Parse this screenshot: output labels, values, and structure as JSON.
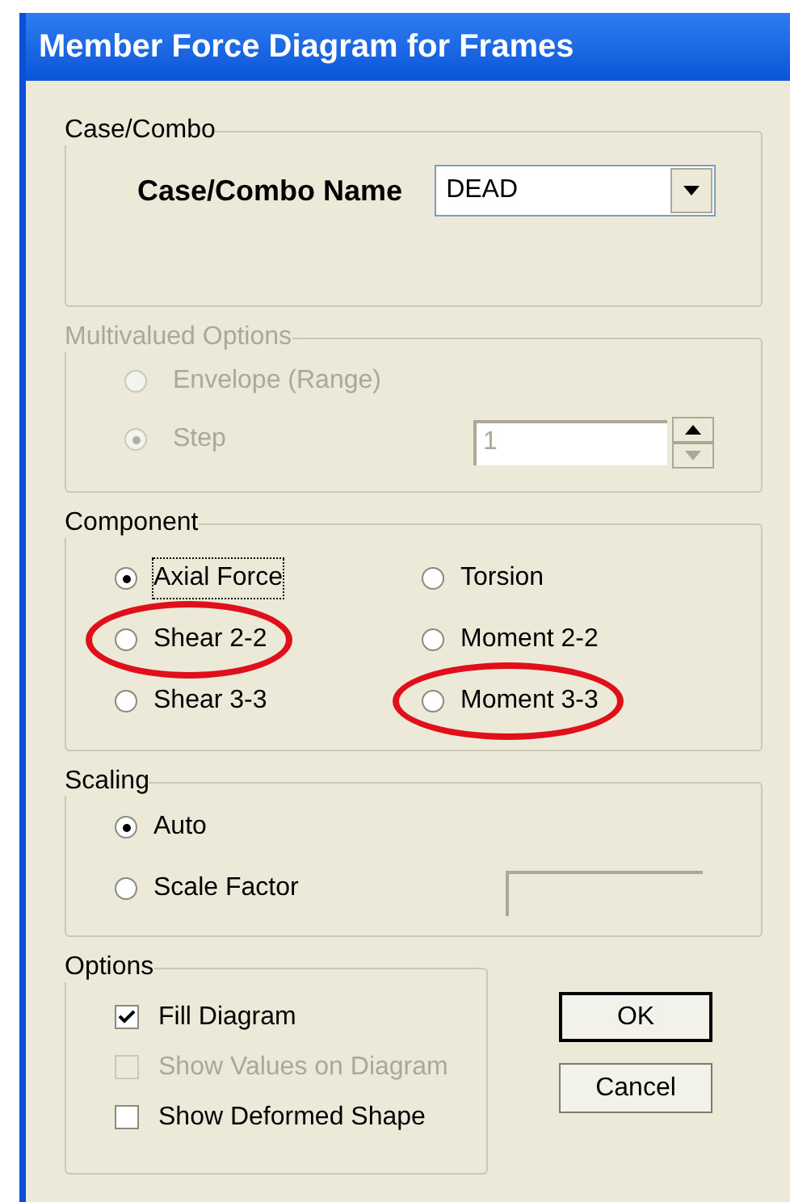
{
  "window": {
    "title": "Member Force Diagram for Frames"
  },
  "case_combo": {
    "title": "Case/Combo",
    "label": "Case/Combo Name",
    "value": "DEAD"
  },
  "multivalued": {
    "title": "Multivalued Options",
    "disabled": true,
    "options": [
      {
        "label": "Envelope (Range)",
        "selected": false
      },
      {
        "label": "Step",
        "selected": true
      }
    ],
    "step_value": "1"
  },
  "component": {
    "title": "Component",
    "options": [
      {
        "label": "Axial Force",
        "selected": true,
        "focused": true,
        "circled": false
      },
      {
        "label": "Torsion",
        "selected": false,
        "focused": false,
        "circled": false
      },
      {
        "label": "Shear 2-2",
        "selected": false,
        "focused": false,
        "circled": true
      },
      {
        "label": "Moment 2-2",
        "selected": false,
        "focused": false,
        "circled": false
      },
      {
        "label": "Shear 3-3",
        "selected": false,
        "focused": false,
        "circled": false
      },
      {
        "label": "Moment 3-3",
        "selected": false,
        "focused": false,
        "circled": true
      }
    ]
  },
  "scaling": {
    "title": "Scaling",
    "options": [
      {
        "label": "Auto",
        "selected": true
      },
      {
        "label": "Scale Factor",
        "selected": false
      }
    ]
  },
  "options": {
    "title": "Options",
    "items": [
      {
        "label": "Fill Diagram",
        "checked": true,
        "disabled": false
      },
      {
        "label": "Show Values on Diagram",
        "checked": false,
        "disabled": true
      },
      {
        "label": "Show Deformed Shape",
        "checked": false,
        "disabled": false
      }
    ]
  },
  "buttons": [
    {
      "label": "OK",
      "default": true
    },
    {
      "label": "Cancel",
      "default": false
    }
  ]
}
